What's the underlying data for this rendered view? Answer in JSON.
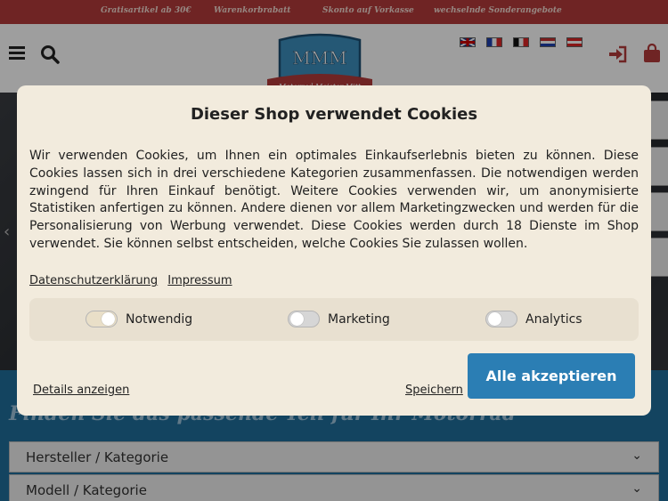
{
  "promo": {
    "items": [
      "Gratisartikel ab 30€",
      "Warenkorbrabatt",
      "Skonto auf Vorkasse",
      "wechselnde Sonderangebote"
    ]
  },
  "header": {
    "logo_text": "MMM",
    "logo_subtext": "Motorrad Meister Mitt",
    "languages": [
      "english-flag",
      "french-flag",
      "belgian-flag",
      "dutch-flag",
      "austrian-flag"
    ]
  },
  "cookie": {
    "title": "Dieser Shop verwendet Cookies",
    "body": "Wir verwenden Cookies, um Ihnen ein optimales Einkaufserlebnis bieten zu können. Diese Cookies lassen sich in drei verschiedene Kategorien zusammenfassen. Die notwendigen werden zwingend für Ihren Einkauf benötigt. Weitere Cookies verwenden wir, um anonymisierte Statistiken anfertigen zu können. Andere dienen vor allem Marketingzwecken und werden für die Personalisierung von Werbung verwendet. Diese Cookies werden durch 18 Dienste im Shop verwendet. Sie können selbst entscheiden, welche Cookies Sie zulassen wollen.",
    "link_privacy": "Datenschutzerklärung",
    "link_imprint": "Impressum",
    "toggle_necessary": "Notwendig",
    "toggle_marketing": "Marketing",
    "toggle_analytics": "Analytics",
    "details": "Details anzeigen",
    "save": "Speichern",
    "accept": "Alle akzeptieren"
  },
  "page": {
    "headline": "Finden Sie das passende Teil für Ihr Motorrad",
    "select_manufacturer": "Hersteller / Kategorie",
    "select_model": "Modell / Kategorie"
  },
  "colors": {
    "promo_bg": "#b33a3a",
    "accent": "#2b7eb4",
    "lower_bg": "#1f6f9c"
  }
}
